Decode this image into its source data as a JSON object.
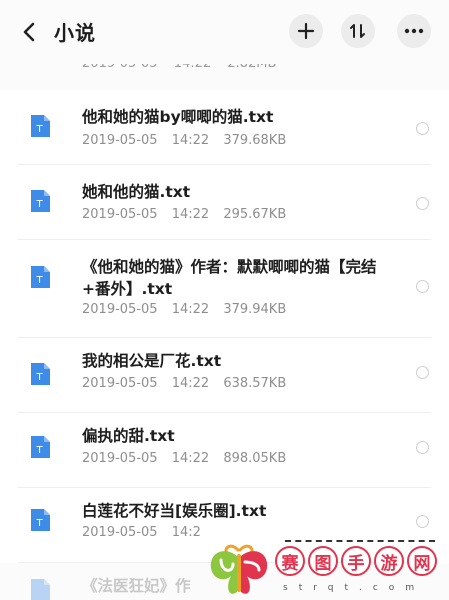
{
  "header": {
    "title": "小说",
    "back_icon": "chevron-left-icon",
    "add_icon": "plus-icon",
    "sort_icon": "sort-icon",
    "more_icon": "more-horizontal-icon"
  },
  "peek_row": {
    "date": "2019-05-05",
    "time": "14:22",
    "size": "2.82MB"
  },
  "files": [
    {
      "name": "他和她的猫by唧唧的猫.txt",
      "date": "2019-05-05",
      "time": "14:22",
      "size": "379.68KB"
    },
    {
      "name": "她和他的猫.txt",
      "date": "2019-05-05",
      "time": "14:22",
      "size": "295.67KB"
    },
    {
      "name": "《他和她的猫》作者：默默唧唧的猫【完结+番外】.txt",
      "date": "2019-05-05",
      "time": "14:22",
      "size": "379.94KB"
    },
    {
      "name": "我的相公是厂花.txt",
      "date": "2019-05-05",
      "time": "14:22",
      "size": "638.57KB"
    },
    {
      "name": "偏执的甜.txt",
      "date": "2019-05-05",
      "time": "14:22",
      "size": "898.05KB"
    },
    {
      "name": "白莲花不好当[娱乐圈].txt",
      "date": "2019-05-05",
      "time": "14:2",
      "size": ""
    }
  ],
  "partial_file": {
    "name": "《法医狂妃》作"
  },
  "file_icon_letter": "T",
  "colors": {
    "file_icon": "#3f8ce8",
    "watermark": "#e0344f"
  },
  "watermark": {
    "chars": [
      "赛",
      "图",
      "手",
      "游",
      "网"
    ],
    "sub": "strqt.com"
  }
}
